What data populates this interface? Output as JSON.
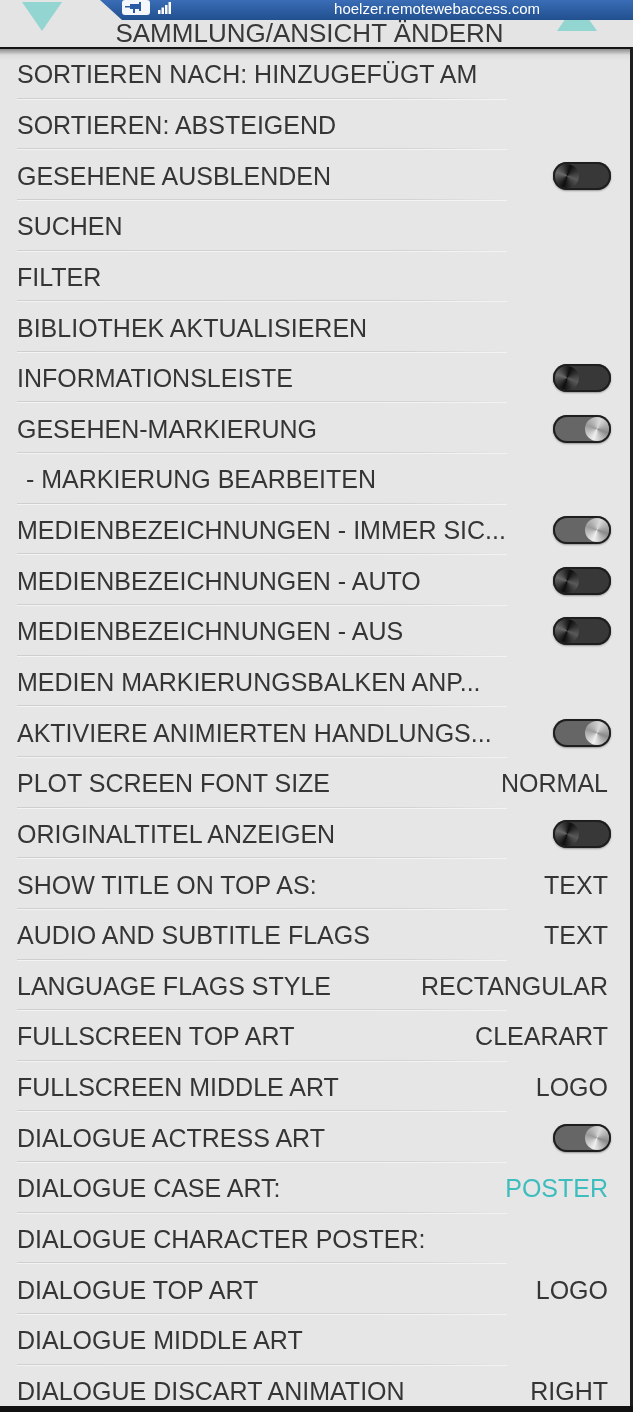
{
  "connection_bar": {
    "address": "hoelzer.remotewebaccess.com"
  },
  "header": {
    "title": "SAMMLUNG/ANSICHT ÄNDERN"
  },
  "rows": [
    {
      "label": "SORTIEREN NACH: HINZUGEFÜGT AM",
      "kind": "action",
      "selected": false
    },
    {
      "label": "SORTIEREN: ABSTEIGEND",
      "kind": "action",
      "selected": false
    },
    {
      "label": "GESEHENE AUSBLENDEN",
      "kind": "toggle",
      "on": false,
      "selected": false
    },
    {
      "label": "SUCHEN",
      "kind": "action",
      "selected": false
    },
    {
      "label": "FILTER",
      "kind": "action",
      "selected": false
    },
    {
      "label": "BIBLIOTHEK AKTUALISIEREN",
      "kind": "action",
      "selected": false
    },
    {
      "label": "INFORMATIONSLEISTE",
      "kind": "toggle",
      "on": false,
      "selected": false
    },
    {
      "label": "GESEHEN-MARKIERUNG",
      "kind": "toggle",
      "on": true,
      "selected": false,
      "children": [
        {
          "label": "- MARKIERUNG BEARBEITEN",
          "kind": "action",
          "selected": false
        }
      ]
    },
    {
      "label": "MEDIENBEZEICHNUNGEN - IMMER SIC...",
      "kind": "toggle",
      "on": true,
      "selected": false
    },
    {
      "label": "MEDIENBEZEICHNUNGEN - AUTO",
      "kind": "toggle",
      "on": false,
      "selected": false
    },
    {
      "label": "MEDIENBEZEICHNUNGEN - AUS",
      "kind": "toggle",
      "on": false,
      "selected": false
    },
    {
      "label": "MEDIEN MARKIERUNGSBALKEN ANP...",
      "kind": "action",
      "selected": false
    },
    {
      "label": "AKTIVIERE ANIMIERTEN HANDLUNGS...",
      "kind": "toggle",
      "on": true,
      "selected": false
    },
    {
      "label": "PLOT SCREEN FONT SIZE",
      "kind": "value",
      "value": "NORMAL",
      "selected": false
    },
    {
      "label": "ORIGINALTITEL ANZEIGEN",
      "kind": "toggle",
      "on": false,
      "selected": false
    },
    {
      "label": "SHOW TITLE ON TOP AS:",
      "kind": "value",
      "value": "TEXT",
      "selected": false
    },
    {
      "label": "AUDIO AND SUBTITLE FLAGS",
      "kind": "value",
      "value": "TEXT",
      "selected": false
    },
    {
      "label": "LANGUAGE FLAGS STYLE",
      "kind": "value",
      "value": "RECTANGULAR",
      "selected": false
    },
    {
      "label": "FULLSCREEN TOP ART",
      "kind": "value",
      "value": "CLEARART",
      "selected": false
    },
    {
      "label": "FULLSCREEN MIDDLE ART",
      "kind": "value",
      "value": "LOGO",
      "selected": false
    },
    {
      "label": "DIALOGUE ACTRESS ART",
      "kind": "toggle",
      "on": true,
      "selected": false
    },
    {
      "label": "DIALOGUE CASE ART:",
      "kind": "value",
      "value": "POSTER",
      "selected": true
    },
    {
      "label": "DIALOGUE CHARACTER POSTER:",
      "kind": "action",
      "selected": false
    },
    {
      "label": "DIALOGUE TOP ART",
      "kind": "value",
      "value": "LOGO",
      "selected": false
    },
    {
      "label": "DIALOGUE MIDDLE ART",
      "kind": "action",
      "selected": false
    },
    {
      "label": "DIALOGUE DISCART ANIMATION",
      "kind": "value",
      "value": "RIGHT",
      "selected": false
    }
  ]
}
